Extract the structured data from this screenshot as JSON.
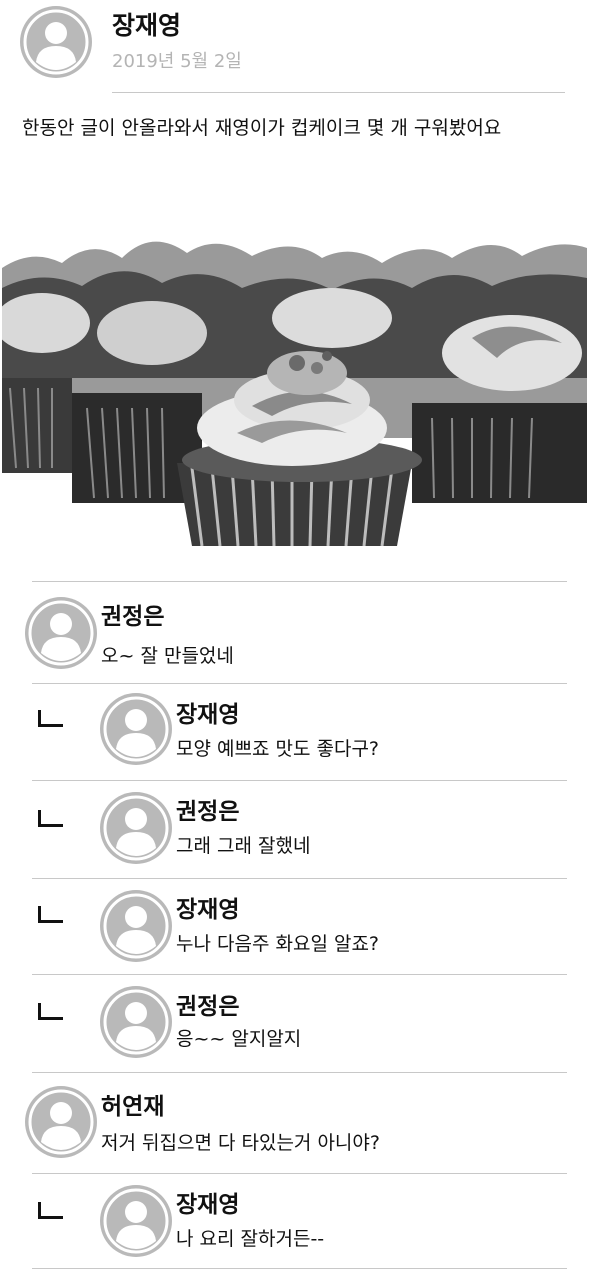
{
  "post": {
    "author": "장재영",
    "date": "2019년 5월 2일",
    "body": "한동안 글이 안올라와서 재영이가 컵케이크 몇 개 구워봤어요",
    "photo_icon": "cupcakes-photo"
  },
  "comments": [
    {
      "name": "권정은",
      "text": "오~ 잘 만들었네"
    },
    {
      "name": "장재영",
      "text": "모양 예쁘죠 맛도 좋다구?"
    },
    {
      "name": "권정은",
      "text": "그래 그래 잘했네"
    },
    {
      "name": "장재영",
      "text": "누나 다음주 화요일 알죠?"
    },
    {
      "name": "권정은",
      "text": "응~~ 알지알지"
    },
    {
      "name": "허연재",
      "text": "저거 뒤집으면 다 타있는거 아니야?"
    },
    {
      "name": "장재영",
      "text": "나 요리 잘하거든--"
    }
  ],
  "icons": {
    "avatar": "user-silhouette-icon",
    "reply": "reply-arrow-icon"
  },
  "colors": {
    "avatar_bg": "#b9b9b9",
    "avatar_fg": "#ffffff",
    "date_text": "#b4b4b4",
    "divider": "#c8c8c8"
  }
}
